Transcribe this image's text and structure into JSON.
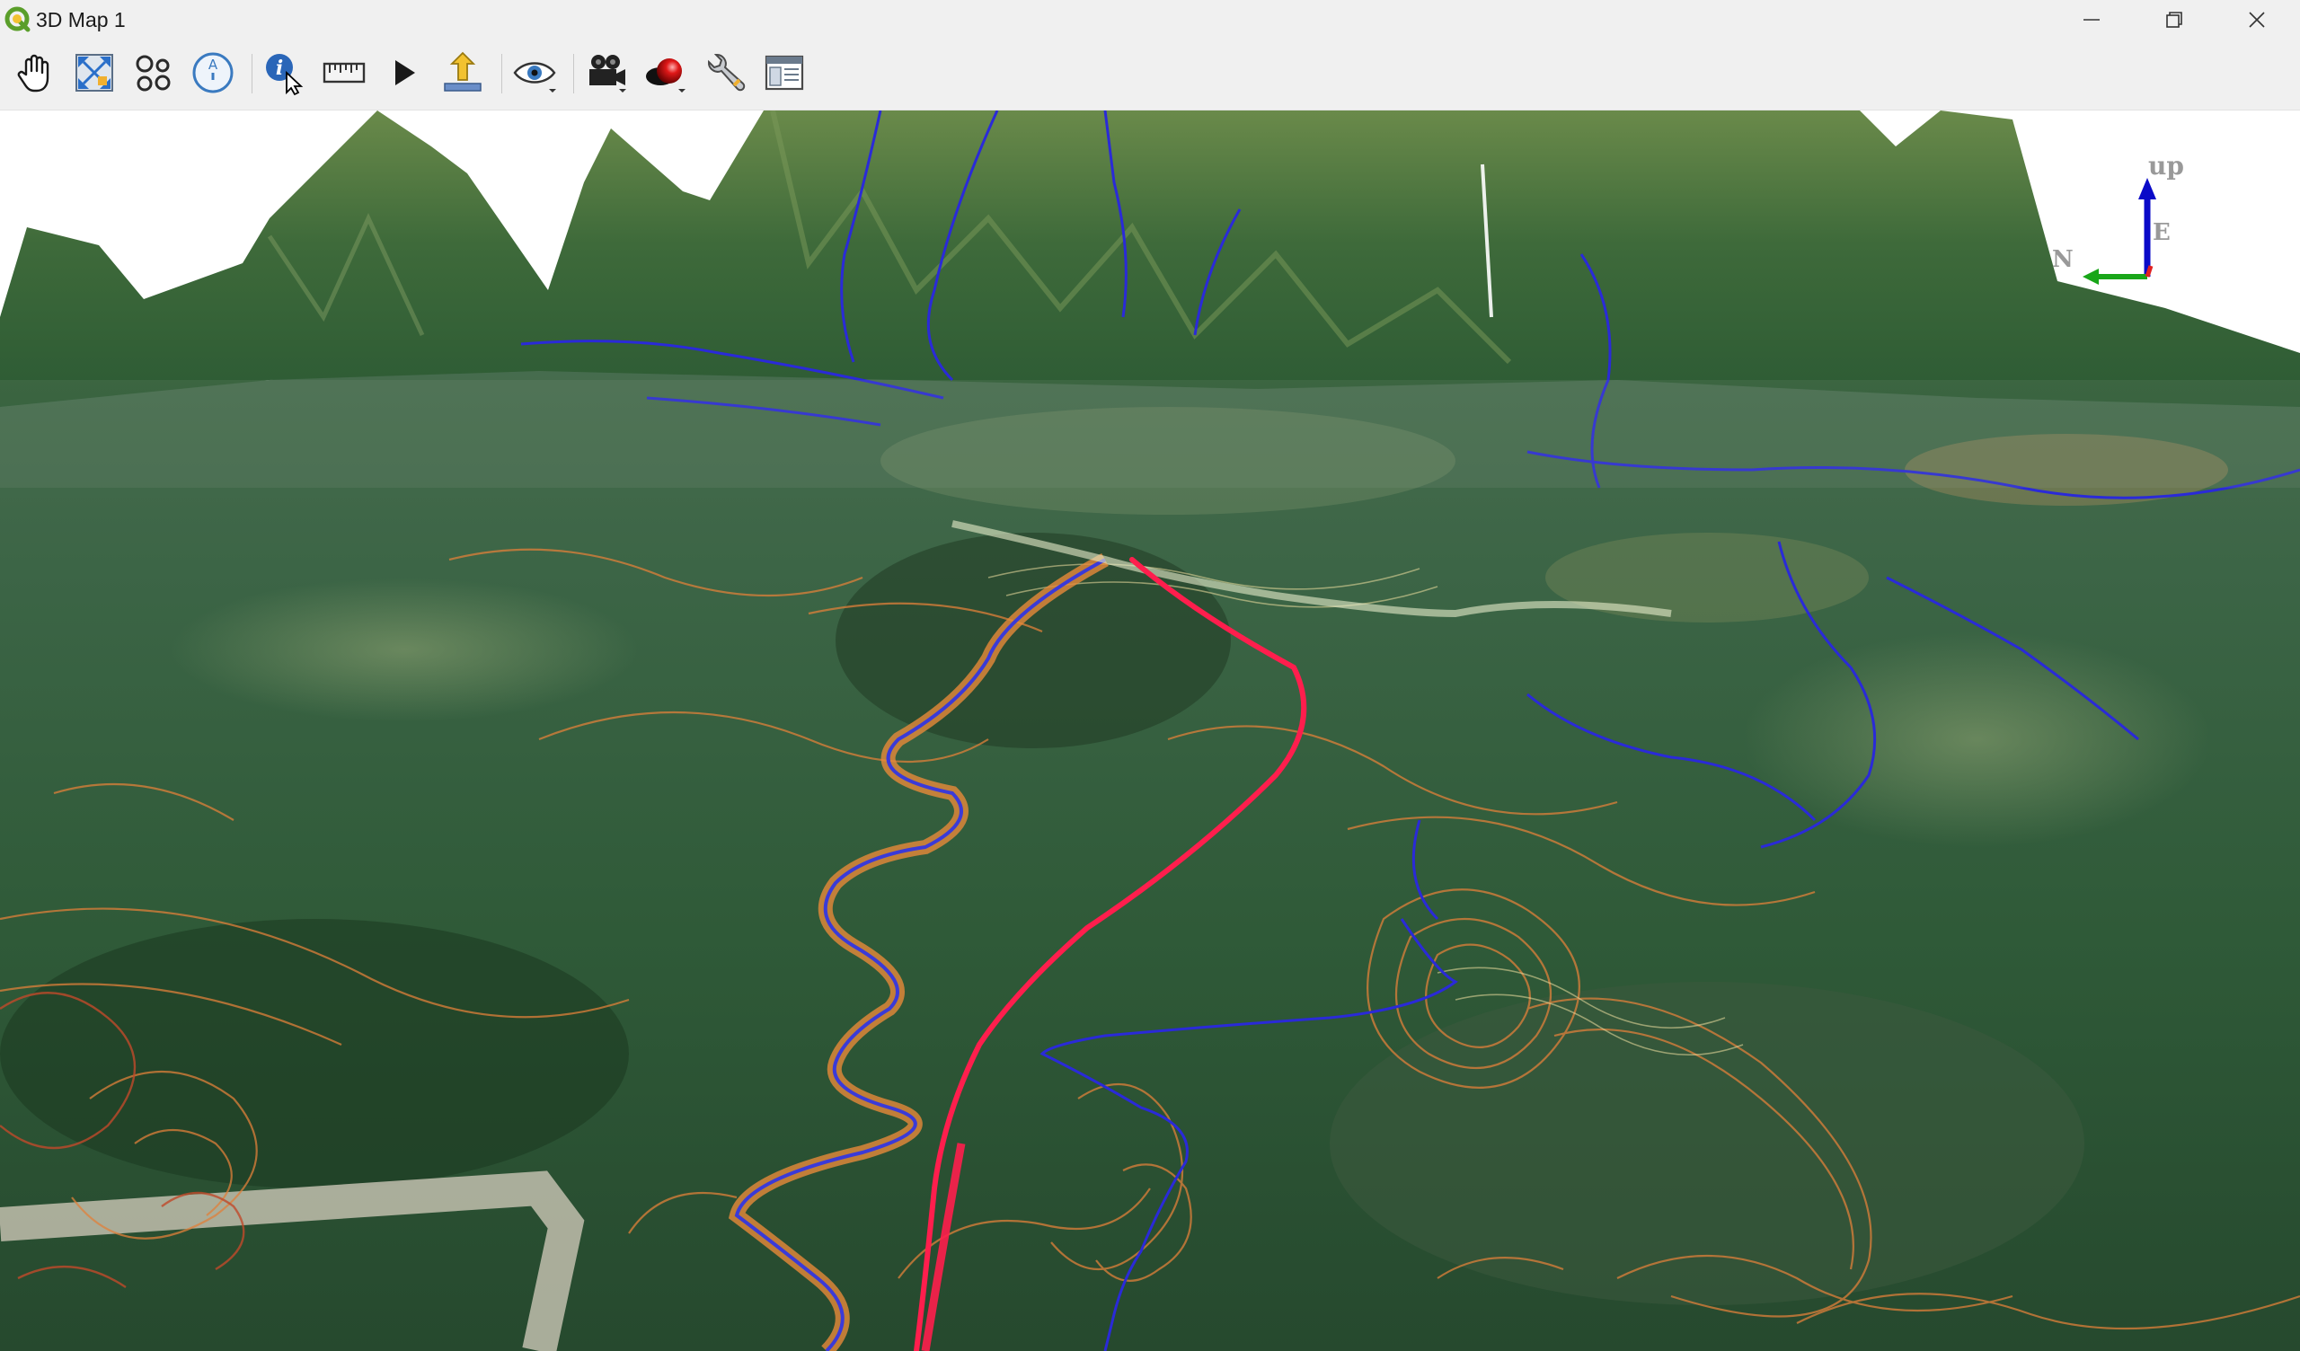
{
  "window": {
    "title": "3D Map 1",
    "controls": [
      "minimize",
      "maximize",
      "close"
    ]
  },
  "toolbar": {
    "tools": [
      {
        "name": "pan-camera-icon"
      },
      {
        "name": "zoom-full-icon"
      },
      {
        "name": "orbit-camera-icon"
      },
      {
        "name": "reset-north-icon",
        "glyph": "A"
      },
      {
        "name": "identify-icon",
        "glyph": "i"
      },
      {
        "name": "measure-line-icon"
      },
      {
        "name": "play-animation-icon"
      },
      {
        "name": "export-icon"
      },
      {
        "name": "camera-eye-icon"
      },
      {
        "name": "record-camera-icon"
      },
      {
        "name": "shadow-effects-icon"
      },
      {
        "name": "configure-icon"
      },
      {
        "name": "dock-window-icon"
      }
    ]
  },
  "navigation_axes": {
    "up_label": "up",
    "east_label": "E",
    "north_label": "N",
    "colors": {
      "up": "#0a0ac8",
      "north": "#19a619",
      "east": "#e02020"
    }
  },
  "scene": {
    "description_layers": [
      "satellite-terrain",
      "contour-lines",
      "streams",
      "selected-route"
    ],
    "colors": {
      "route": "#ff1e4d",
      "streams": "#2a2ad8",
      "contours": "#e0803a"
    }
  }
}
